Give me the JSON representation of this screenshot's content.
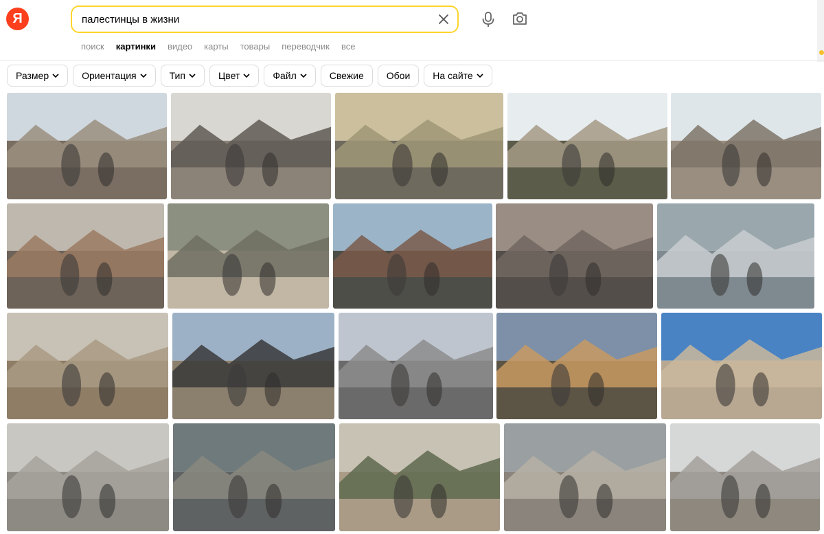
{
  "logo": {
    "letter": "Я"
  },
  "search": {
    "query": "палестинцы в жизни"
  },
  "services": [
    {
      "label": "поиск",
      "active": false
    },
    {
      "label": "картинки",
      "active": true
    },
    {
      "label": "видео",
      "active": false
    },
    {
      "label": "карты",
      "active": false
    },
    {
      "label": "товары",
      "active": false
    },
    {
      "label": "переводчик",
      "active": false
    },
    {
      "label": "все",
      "active": false
    }
  ],
  "filters": [
    {
      "label": "Размер",
      "dropdown": true
    },
    {
      "label": "Ориентация",
      "dropdown": true
    },
    {
      "label": "Тип",
      "dropdown": true
    },
    {
      "label": "Цвет",
      "dropdown": true
    },
    {
      "label": "Файл",
      "dropdown": true
    },
    {
      "label": "Свежие",
      "dropdown": false
    },
    {
      "label": "Обои",
      "dropdown": false
    },
    {
      "label": "На сайте",
      "dropdown": true
    }
  ],
  "icons": {
    "clear": "close-icon",
    "voice": "microphone-icon",
    "image_search": "camera-icon"
  },
  "colors": {
    "accent": "#fed42b",
    "logo": "#fc3f1d"
  },
  "results": [
    {
      "subject": "street-with-children",
      "sky": "#cfd8de",
      "ground": "#7a6e62",
      "mid": "#9b8f80"
    },
    {
      "subject": "woman-carrying-child-flooded-street",
      "sky": "#d9d7d2",
      "ground": "#8c8378",
      "mid": "#5f5a55"
    },
    {
      "subject": "man-arguing-with-soldier",
      "sky": "#cbbf9e",
      "ground": "#6f6a5e",
      "mid": "#a09675"
    },
    {
      "subject": "elderly-man-with-cane-and-flag",
      "sky": "#e7ecef",
      "ground": "#5c5c4a",
      "mid": "#a49a86"
    },
    {
      "subject": "woman-in-rubble",
      "sky": "#dfe6ea",
      "ground": "#9a8e80",
      "mid": "#7f7468"
    },
    {
      "subject": "woman-in-embroidered-dress-crowd",
      "sky": "#bfb8ae",
      "ground": "#6e6359",
      "mid": "#9b7a62"
    },
    {
      "subject": "family-outside-house",
      "sky": "#8c9081",
      "ground": "#c2b7a4",
      "mid": "#6e6f62"
    },
    {
      "subject": "children-with-armed-men",
      "sky": "#9bb4c8",
      "ground": "#4e4e48",
      "mid": "#7a5a4a"
    },
    {
      "subject": "destroyed-building-people",
      "sky": "#9a8d84",
      "ground": "#544e4a",
      "mid": "#726760"
    },
    {
      "subject": "schoolgirls-crowd",
      "sky": "#9aa7ad",
      "ground": "#7f8a90",
      "mid": "#c8ccd0"
    },
    {
      "subject": "bombed-buildings-with-flag",
      "sky": "#c7c2b5",
      "ground": "#8f7d66",
      "mid": "#a99a84"
    },
    {
      "subject": "boy-in-front-of-smoke",
      "sky": "#9cb1c5",
      "ground": "#8b7f6e",
      "mid": "#3a3a3a"
    },
    {
      "subject": "crowd-confrontation",
      "sky": "#bfc5cf",
      "ground": "#6a6a6a",
      "mid": "#8c8c8c"
    },
    {
      "subject": "person-with-flag-sunset",
      "sky": "#7d90a8",
      "ground": "#5c5444",
      "mid": "#c79a62"
    },
    {
      "subject": "old-town-street-with-woman",
      "sky": "#4a83c4",
      "ground": "#b8a892",
      "mid": "#c9b89c"
    },
    {
      "subject": "ruined-houses-aerial",
      "sky": "#c9c7c2",
      "ground": "#8d8a84",
      "mid": "#a7a39c"
    },
    {
      "subject": "street-clashes",
      "sky": "#6f7a7c",
      "ground": "#5e6262",
      "mid": "#8a8a80"
    },
    {
      "subject": "scout-parade-with-flags",
      "sky": "#c8c2b4",
      "ground": "#a99b86",
      "mid": "#5e6a4e"
    },
    {
      "subject": "elderly-man-sitting-masks",
      "sky": "#9aa0a2",
      "ground": "#8a847c",
      "mid": "#b6b0a6"
    },
    {
      "subject": "woman-near-tent",
      "sky": "#d6d8d8",
      "ground": "#8e887e",
      "mid": "#a4a19c"
    }
  ]
}
